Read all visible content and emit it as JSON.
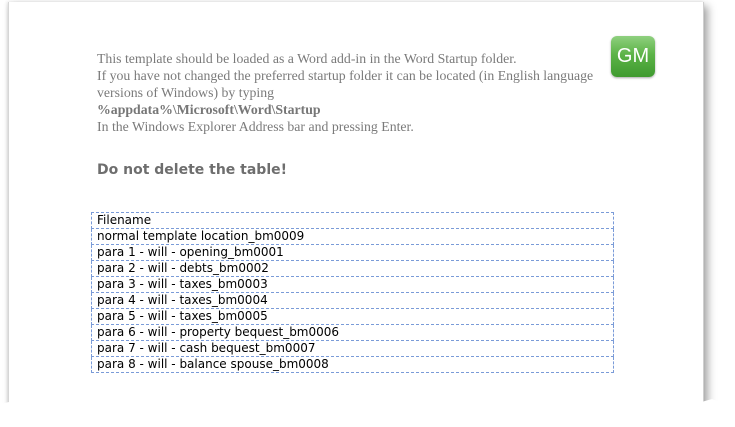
{
  "intro": {
    "line1": "This template should be loaded as a Word add-in in the Word Startup folder.",
    "line2": "If you have not changed the preferred startup folder it can be located (in English language versions of Windows) by typing",
    "path": "%appdata%\\Microsoft\\Word\\Startup",
    "line4": "In the Windows Explorer Address bar and pressing  Enter."
  },
  "logo": {
    "text": "GM"
  },
  "heading": "Do not delete the table!",
  "table": {
    "header": "Filename",
    "rows": [
      "normal template location_bm0009",
      "para 1 - will - opening_bm0001",
      "para 2 - will - debts_bm0002",
      "para 3 - will - taxes_bm0003",
      "para 4 - will - taxes_bm0004",
      "para 5 - will - taxes_bm0005",
      "para 6 - will - property bequest_bm0006",
      "para 7 - will - cash bequest_bm0007",
      "para 8 - will - balance spouse_bm0008"
    ]
  }
}
